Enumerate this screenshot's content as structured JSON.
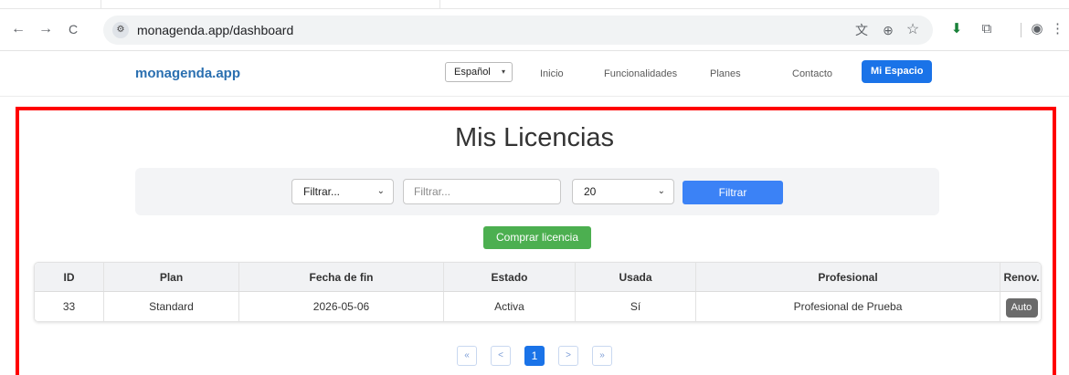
{
  "browser": {
    "url": "monagenda.app/dashboard",
    "back_icon": "arrow-left-icon",
    "forward_icon": "arrow-right-icon",
    "reload_icon": "reload-icon",
    "site_settings_icon": "tune-icon",
    "back_glyph": "←",
    "forward_glyph": "→",
    "reload_glyph": "C",
    "tune_glyph": "⚙",
    "translate_glyph": "文",
    "zoom_glyph": "⊕",
    "star_glyph": "☆",
    "download_glyph": "⬇",
    "extensions_glyph": "⧉",
    "profile_glyph": "◉",
    "menu_glyph": "⋮"
  },
  "site_nav": {
    "brand": "monagenda.app",
    "language": "Español",
    "language_caret": "▾",
    "links": [
      "Inicio",
      "Funcionalidades",
      "Planes",
      "Contacto"
    ],
    "active_link": "Mi Espacio"
  },
  "main": {
    "title": "Mis Licencias",
    "filter": {
      "field_select": "Filtrar...",
      "search_placeholder": "Filtrar...",
      "page_size": "20",
      "chevron": "⌄",
      "submit_label": "Filtrar"
    },
    "buy_button": "Comprar licencia",
    "table": {
      "headers": [
        "ID",
        "Plan",
        "Fecha de fin",
        "Estado",
        "Usada",
        "Profesional",
        "Renov."
      ],
      "rows": [
        {
          "id": "33",
          "plan": "Standard",
          "end_date": "2026-05-06",
          "status": "Activa",
          "used": "Sí",
          "professional": "Profesional de Prueba",
          "renewal": "Auto"
        }
      ]
    },
    "pagination": {
      "first": "«",
      "prev": "<",
      "current": "1",
      "next": ">",
      "last": "»"
    }
  },
  "colors": {
    "brand": "#2a6fb0",
    "primary": "#1a73e8",
    "filter_button": "#3b82f6",
    "buy_button": "#4caf50",
    "highlight_frame": "#ff0000"
  }
}
